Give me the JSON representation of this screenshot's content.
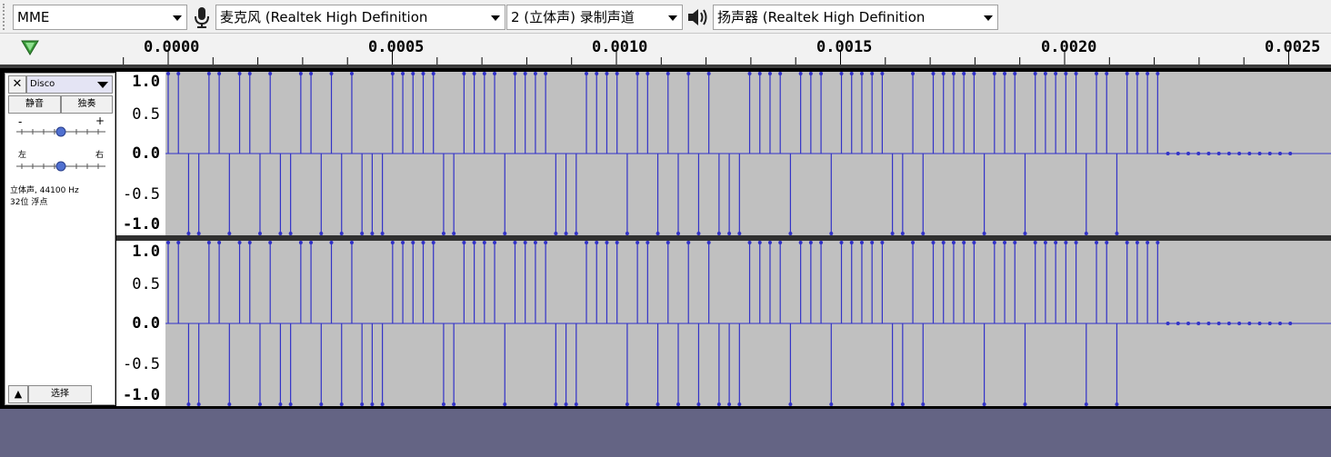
{
  "device_toolbar": {
    "host": "MME",
    "mic_device": "麦克风 (Realtek High Definition",
    "channels": "2 (立体声) 录制声道",
    "speaker_device": "扬声器 (Realtek High Definition"
  },
  "ruler": {
    "labels": [
      "0.0000",
      "0.0005",
      "0.0010",
      "0.0015",
      "0.0020",
      "0.0025"
    ]
  },
  "track": {
    "name": "Disco",
    "mute_label": "静音",
    "solo_label": "独奏",
    "gain_minus": "-",
    "gain_plus": "+",
    "pan_left": "左",
    "pan_right": "右",
    "info_line1": "立体声, 44100 Hz",
    "info_line2": "32位 浮点",
    "select_label": "选择"
  },
  "vscale": {
    "labels": [
      "1.0",
      "0.5",
      "0.0",
      "-0.5",
      "-1.0"
    ]
  },
  "samples": {
    "pattern": [
      1,
      1,
      -1,
      -1,
      1,
      1,
      -1,
      1,
      1,
      -1,
      1,
      -1,
      -1,
      1,
      1,
      -1,
      1,
      -1,
      1,
      -1,
      -1,
      -1,
      1,
      1,
      1,
      1,
      1,
      -1,
      -1,
      1,
      1,
      1,
      1,
      -1,
      1,
      1,
      1,
      1,
      -1,
      -1,
      -1,
      1,
      1,
      1,
      1,
      -1,
      1,
      1,
      -1,
      1,
      -1,
      1,
      -1,
      1,
      -1,
      -1,
      -1,
      1,
      1,
      1,
      1,
      -1,
      1,
      1,
      1,
      -1,
      1,
      1,
      1,
      1,
      1,
      -1,
      -1,
      1,
      -1,
      1,
      1,
      1,
      1,
      1,
      -1,
      1,
      1,
      1,
      -1,
      1,
      1,
      1,
      1,
      1,
      -1,
      1,
      1,
      -1,
      1,
      1,
      1,
      1,
      0,
      0,
      0,
      0,
      0,
      0,
      0,
      0,
      0,
      0,
      0,
      0,
      0
    ]
  },
  "colors": {
    "waveform": "#3232c8",
    "wave_bg": "#c0c0c0",
    "bottom_bg": "#646484",
    "play_marker": "#3a9a3a"
  }
}
